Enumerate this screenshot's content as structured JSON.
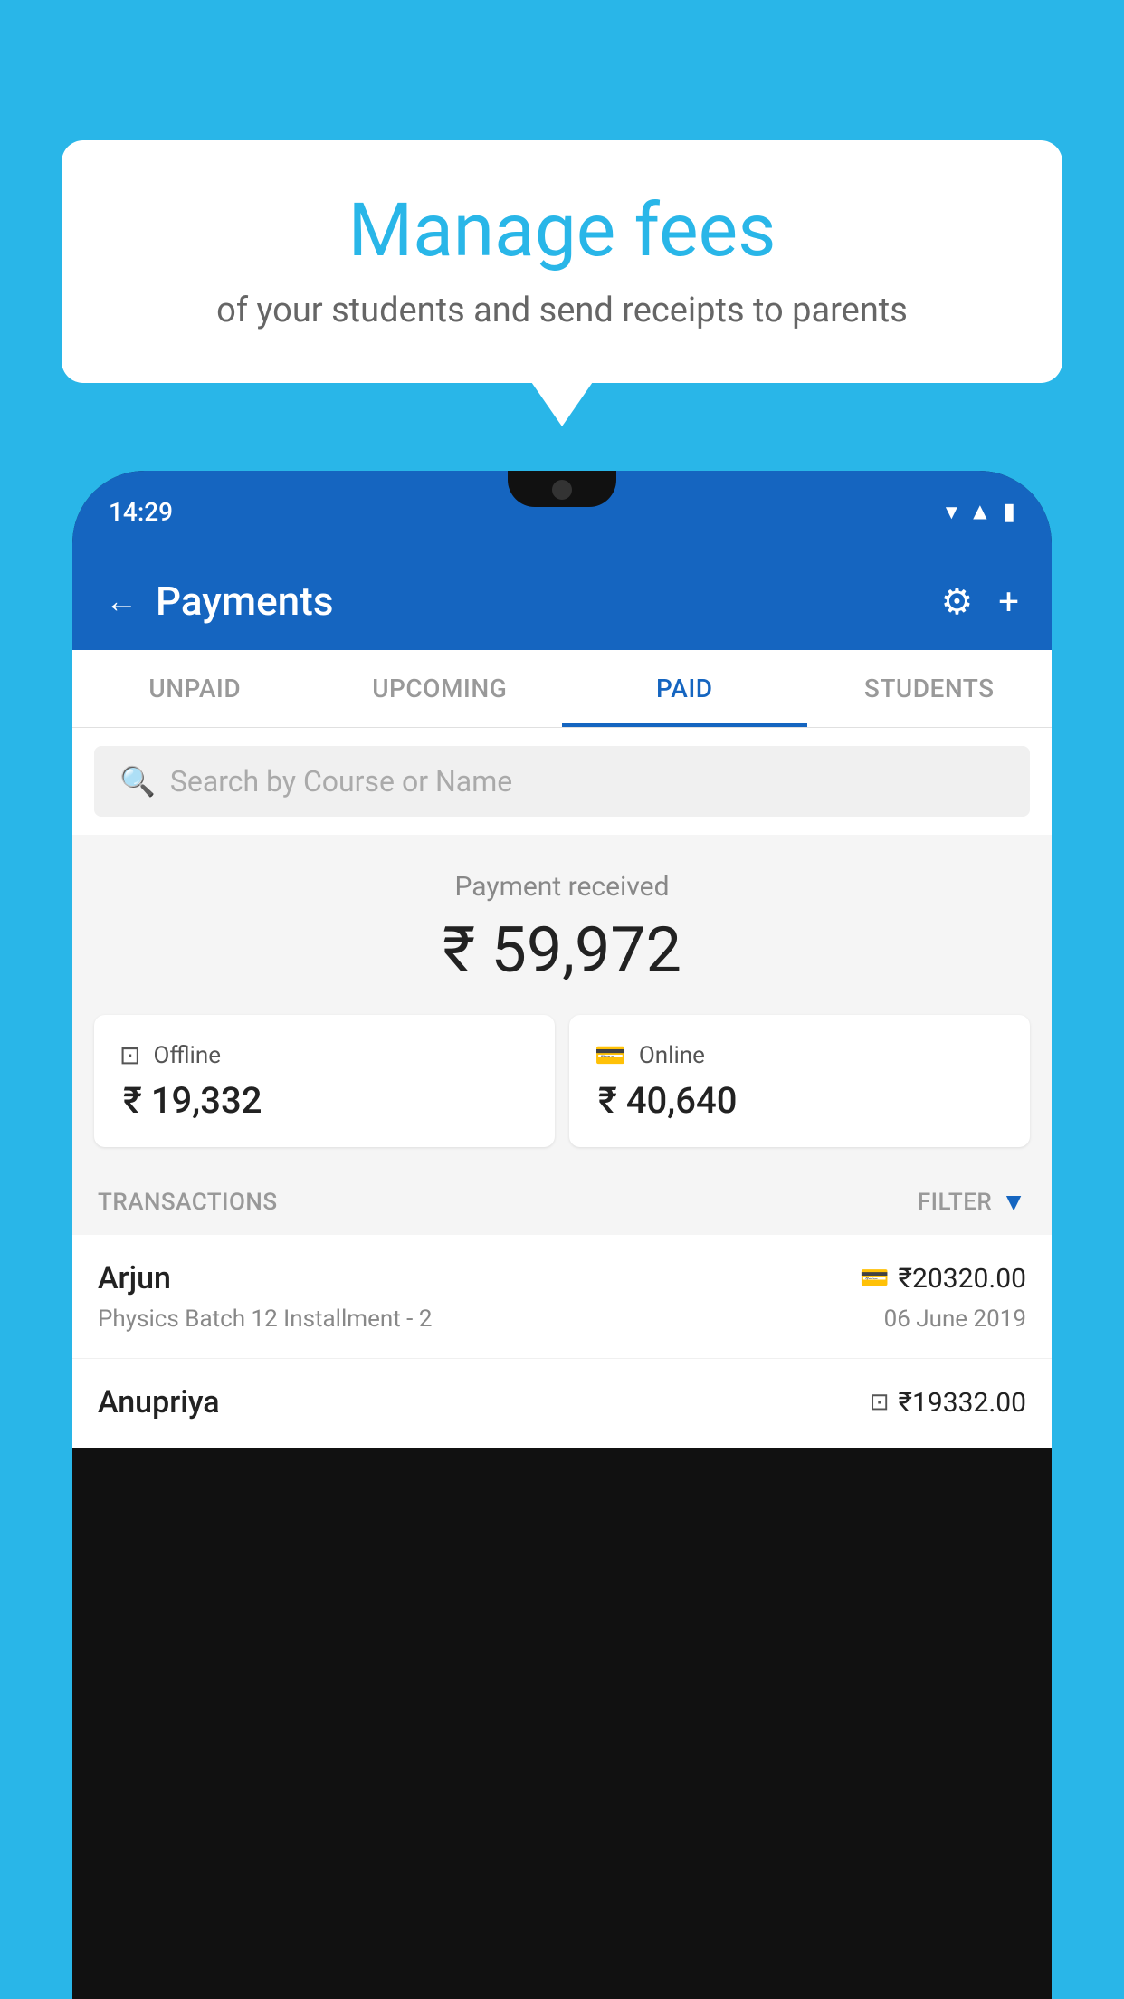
{
  "background": {
    "color": "#29B6E8"
  },
  "bubble": {
    "title": "Manage fees",
    "subtitle": "of your students and send receipts to parents"
  },
  "status_bar": {
    "time": "14:29"
  },
  "header": {
    "title": "Payments",
    "back_label": "←",
    "settings_label": "⚙",
    "add_label": "+"
  },
  "tabs": [
    {
      "label": "UNPAID",
      "active": false
    },
    {
      "label": "UPCOMING",
      "active": false
    },
    {
      "label": "PAID",
      "active": true
    },
    {
      "label": "STUDENTS",
      "active": false
    }
  ],
  "search": {
    "placeholder": "Search by Course or Name"
  },
  "payment_summary": {
    "label": "Payment received",
    "total": "₹ 59,972",
    "offline": {
      "type": "Offline",
      "amount": "₹ 19,332"
    },
    "online": {
      "type": "Online",
      "amount": "₹ 40,640"
    }
  },
  "transactions": {
    "header_label": "TRANSACTIONS",
    "filter_label": "FILTER",
    "items": [
      {
        "name": "Arjun",
        "amount": "₹20320.00",
        "course": "Physics Batch 12 Installment - 2",
        "date": "06 June 2019",
        "mode": "card"
      },
      {
        "name": "Anupriya",
        "amount": "₹19332.00",
        "course": "",
        "date": "",
        "mode": "cash"
      }
    ]
  }
}
